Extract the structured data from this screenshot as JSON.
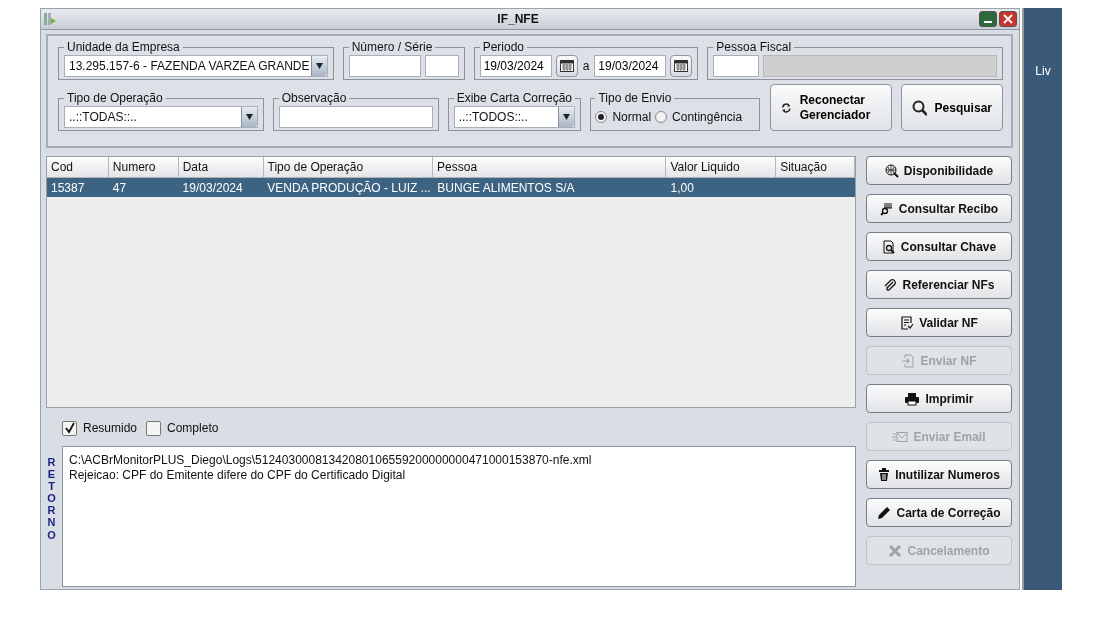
{
  "window": {
    "title": "IF_NFE"
  },
  "filters": {
    "empresa": {
      "label": "Unidade da Empresa",
      "value": "13.295.157-6 - FAZENDA VARZEA GRANDE"
    },
    "numero_serie": {
      "label": "Número / Série"
    },
    "periodo": {
      "label": "Periodo",
      "from": "19/03/2024",
      "separator": "a",
      "to": "19/03/2024"
    },
    "pessoa_fiscal": {
      "label": "Pessoa Fiscal"
    },
    "tipo_operacao": {
      "label": "Tipo de Operação",
      "value": "..::TODAS::.."
    },
    "observacao": {
      "label": "Observação"
    },
    "exibe_carta": {
      "label": "Exibe Carta Correção",
      "value": "..::TODOS::.."
    },
    "tipo_envio": {
      "label": "Tipo de Envio",
      "options": [
        {
          "label": "Normal",
          "selected": true
        },
        {
          "label": "Contingência",
          "selected": false
        }
      ]
    }
  },
  "top_buttons": [
    {
      "label": "Reconectar Gerenciador"
    },
    {
      "label": "Pesquisar"
    }
  ],
  "table": {
    "columns": [
      "Cod",
      "Numero",
      "Data",
      "Tipo de Operação",
      "Pessoa",
      "Valor Liquido",
      "Situação"
    ],
    "rows": [
      {
        "cells": [
          "15387",
          "47",
          "19/03/2024",
          "VENDA PRODUÇÃO - LUIZ ...",
          "BUNGE ALIMENTOS S/A",
          "1,00",
          ""
        ],
        "selected": true
      }
    ]
  },
  "side_buttons": [
    {
      "label": "Disponibilidade",
      "disabled": false
    },
    {
      "label": "Consultar Recibo",
      "disabled": false
    },
    {
      "label": "Consultar Chave",
      "disabled": false
    },
    {
      "label": "Referenciar NFs",
      "disabled": false
    },
    {
      "label": "Validar NF",
      "disabled": false
    },
    {
      "label": "Enviar NF",
      "disabled": true
    },
    {
      "label": "Imprimir",
      "disabled": false
    },
    {
      "label": "Enviar Email",
      "disabled": true
    },
    {
      "label": "Inutilizar Numeros",
      "disabled": false
    },
    {
      "label": "Carta de Correção",
      "disabled": false
    },
    {
      "label": "Cancelamento",
      "disabled": true
    }
  ],
  "output_options": [
    {
      "label": "Resumido",
      "checked": true
    },
    {
      "label": "Completo",
      "checked": false
    }
  ],
  "retorno": {
    "label": "RETORNO",
    "lines": [
      "C:\\ACBrMonitorPLUS_Diego\\Logs\\51240300081342080106559200000000471000153870-nfe.xml",
      "Rejeicao: CPF do Emitente difere do CPF do Certificado Digital"
    ]
  },
  "side_panel": {
    "label": "Liv"
  }
}
